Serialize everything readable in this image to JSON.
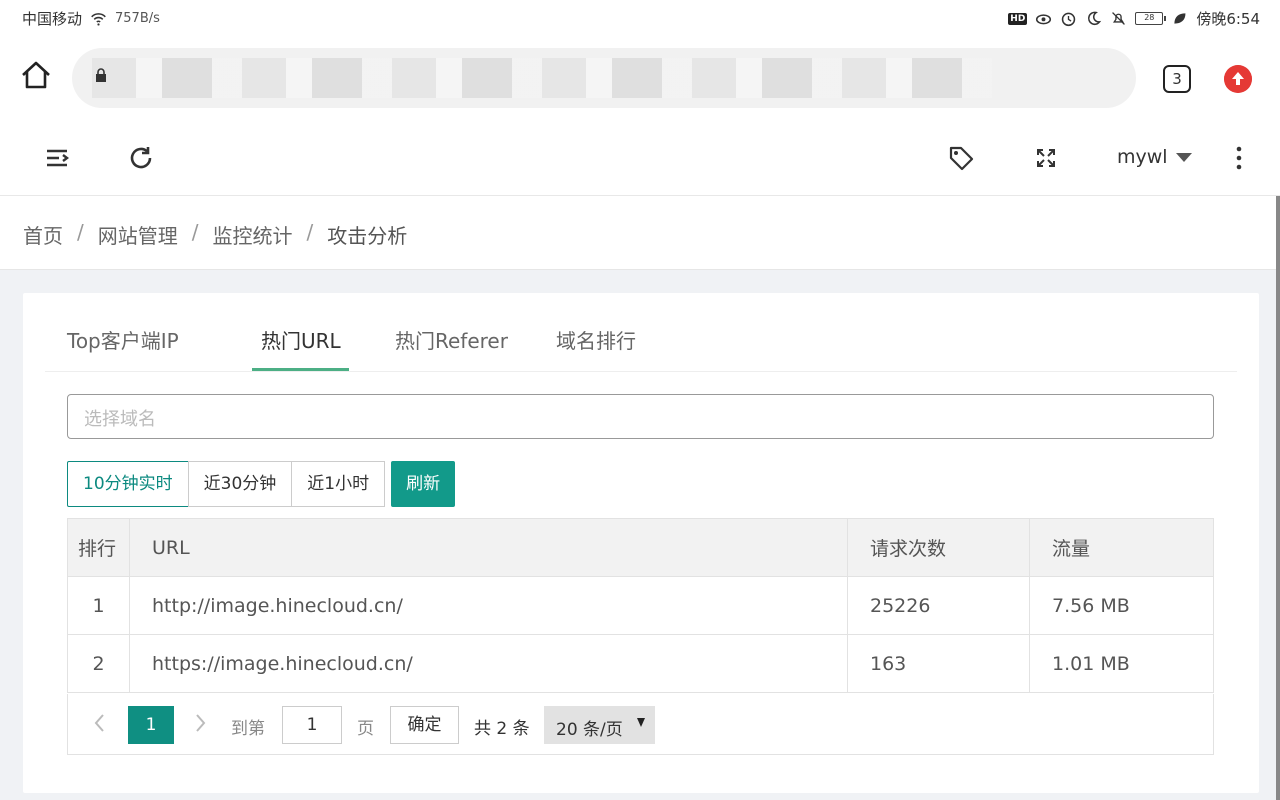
{
  "status_bar": {
    "carrier": "中国移动",
    "speed": "757B/s",
    "time": "傍晚6:54",
    "battery": "28"
  },
  "browser": {
    "tab_count": "3"
  },
  "header": {
    "username": "mywl"
  },
  "breadcrumb": [
    "首页",
    "网站管理",
    "监控统计",
    "攻击分析"
  ],
  "tabs": [
    "Top客户端IP",
    "热门URL",
    "热门Referer",
    "域名排行"
  ],
  "active_tab": "热门URL",
  "domain_select": {
    "placeholder": "选择域名"
  },
  "time_range": {
    "options": [
      "10分钟实时",
      "近30分钟",
      "近1小时"
    ],
    "selected": "10分钟实时",
    "refresh_label": "刷新"
  },
  "table": {
    "headers": [
      "排行",
      "URL",
      "请求次数",
      "流量"
    ],
    "rows": [
      [
        "1",
        "http://image.hinecloud.cn/",
        "25226",
        "7.56 MB"
      ],
      [
        "2",
        "https://image.hinecloud.cn/",
        "163",
        "1.01 MB"
      ]
    ]
  },
  "pager": {
    "current_page": "1",
    "goto_prefix": "到第",
    "goto_value": "1",
    "goto_suffix": "页",
    "confirm": "确定",
    "total": "共 2 条",
    "page_size": "20 条/页"
  },
  "colors": {
    "accent": "#129a8a",
    "tab_ink": "#4caf85",
    "upload_red": "#e53935"
  }
}
